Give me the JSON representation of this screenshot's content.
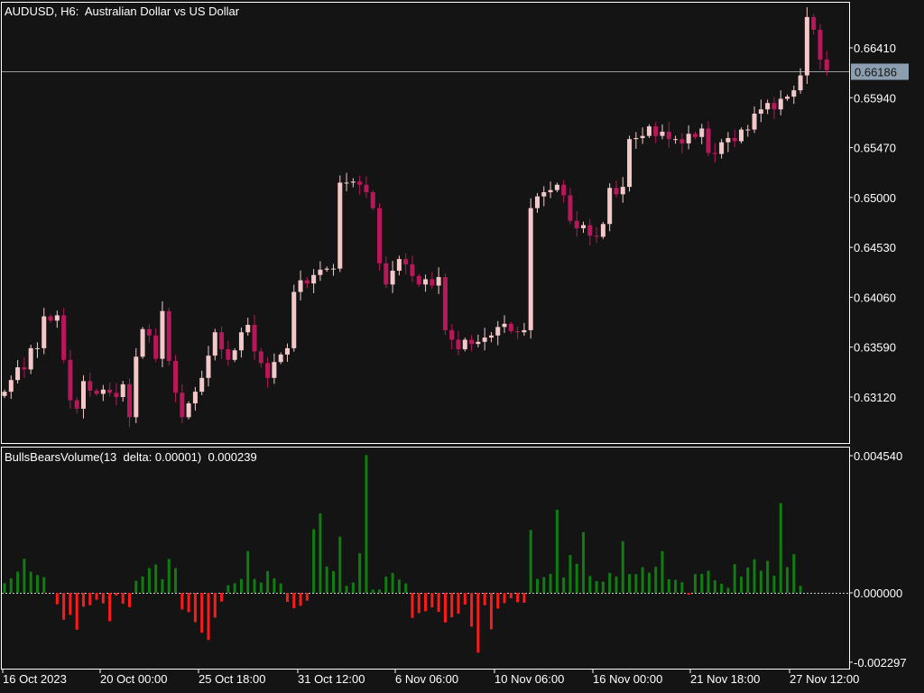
{
  "header": {
    "symbol_line": "AUDUSD, H6:  Australian Dollar vs US Dollar"
  },
  "indicator": {
    "label": "BullsBearsVolume(13  delta: 0.00001)  0.000239"
  },
  "colors": {
    "background": "#141414",
    "grid_border": "#ffffff",
    "bull_candle": "#f3c8c8",
    "bear_candle": "#b8185a",
    "bull_bar": "#0f7d0f",
    "bear_bar": "#ff1a1a",
    "price_line": "#9a9a9a",
    "current_price_box": "#8c9fb0"
  },
  "chart_data": [
    {
      "type": "candlestick",
      "title": "AUDUSD, H6:  Australian Dollar vs US Dollar",
      "ylim": [
        0.6283,
        0.6695
      ],
      "y_ticks": [
        "0.66410",
        "0.65940",
        "0.65470",
        "0.65000",
        "0.64530",
        "0.64060",
        "0.63590",
        "0.63120"
      ],
      "y_tick_values": [
        0.6641,
        0.6594,
        0.6547,
        0.65,
        0.6453,
        0.6406,
        0.6359,
        0.6312
      ],
      "current_price": 0.66186,
      "current_price_label": "0.66186",
      "x_labels": [
        "16 Oct 2023",
        "20 Oct 00:00",
        "25 Oct 18:00",
        "31 Oct 12:00",
        "6 Nov 06:00",
        "10 Nov 06:00",
        "16 Nov 00:00",
        "21 Nov 18:00",
        "27 Nov 12:00"
      ],
      "close": [
        0.6317,
        0.6328,
        0.634,
        0.6338,
        0.6358,
        0.6358,
        0.6388,
        0.6384,
        0.6389,
        0.6347,
        0.6309,
        0.6301,
        0.6327,
        0.6318,
        0.6315,
        0.6319,
        0.6316,
        0.6312,
        0.6324,
        0.6293,
        0.635,
        0.6376,
        0.637,
        0.6348,
        0.6393,
        0.6346,
        0.6316,
        0.6293,
        0.6306,
        0.6317,
        0.633,
        0.6351,
        0.6373,
        0.6357,
        0.6347,
        0.6356,
        0.6373,
        0.638,
        0.6355,
        0.6344,
        0.633,
        0.6345,
        0.6352,
        0.6358,
        0.6411,
        0.6422,
        0.6419,
        0.6427,
        0.6432,
        0.6433,
        0.6433,
        0.6514,
        0.6514,
        0.6515,
        0.6512,
        0.6505,
        0.649,
        0.6438,
        0.6418,
        0.6431,
        0.6442,
        0.6437,
        0.6426,
        0.6418,
        0.6423,
        0.6417,
        0.6425,
        0.6375,
        0.6366,
        0.6357,
        0.6366,
        0.6362,
        0.6364,
        0.6368,
        0.637,
        0.6378,
        0.6381,
        0.6374,
        0.6373,
        0.6375,
        0.649,
        0.6501,
        0.6505,
        0.6507,
        0.6512,
        0.6502,
        0.6478,
        0.6471,
        0.6474,
        0.6464,
        0.6463,
        0.6475,
        0.6509,
        0.6503,
        0.651,
        0.6555,
        0.6556,
        0.6558,
        0.6567,
        0.6558,
        0.6562,
        0.6555,
        0.6555,
        0.6551,
        0.656,
        0.6557,
        0.6565,
        0.6542,
        0.6541,
        0.6552,
        0.6556,
        0.6553,
        0.6564,
        0.6564,
        0.6579,
        0.6583,
        0.6589,
        0.6583,
        0.6593,
        0.6595,
        0.6601,
        0.6615,
        0.667,
        0.6658,
        0.663,
        0.662
      ],
      "volume": [
        0.00032,
        0.00048,
        0.0007,
        0.00113,
        0.0007,
        0.00059,
        0.00052,
        0.0,
        -0.00038,
        -0.00089,
        -0.00073,
        -0.00122,
        -0.00046,
        -0.00041,
        -0.00023,
        -0.00035,
        -0.00094,
        -9e-05,
        -0.00036,
        -0.00047,
        0.0004,
        0.00054,
        0.00082,
        0.00094,
        0.00045,
        0.00112,
        0.00082,
        -0.00055,
        -0.00064,
        -0.00097,
        -0.00132,
        -0.00156,
        -0.00082,
        -0.00029,
        0.00025,
        0.00032,
        0.00046,
        0.00138,
        0.00046,
        0.00034,
        0.00072,
        0.00048,
        0.00031,
        -0.0003,
        -0.00051,
        -0.00043,
        -0.00026,
        0.00211,
        0.00263,
        0.00087,
        0.00072,
        0.00186,
        0.00023,
        0.00034,
        0.00131,
        0.00456,
        0.00011,
        0.00011,
        0.00054,
        0.00066,
        0.00044,
        0.00031,
        -0.00083,
        -0.00067,
        -0.00061,
        -0.00048,
        -0.00063,
        -0.00098,
        -0.00081,
        -0.00069,
        -0.00039,
        -0.00112,
        -0.00198,
        -0.00041,
        -0.00121,
        -0.00052,
        -0.00034,
        -0.00018,
        -0.00031,
        -0.00033,
        0.00208,
        0.00046,
        0.00052,
        0.00063,
        0.00275,
        0.00051,
        0.00125,
        0.00096,
        0.00201,
        0.00056,
        0.00039,
        0.00037,
        0.00066,
        0.00054,
        0.00171,
        0.00062,
        0.00062,
        0.00085,
        0.00067,
        0.00086,
        0.00138,
        0.00045,
        0.00043,
        0.00035,
        -6e-05,
        0.00062,
        0.00063,
        0.00073,
        0.00042,
        0.0003,
        0.00017,
        0.00095,
        0.00054,
        0.00084,
        0.00111,
        0.00073,
        0.00106,
        0.00057,
        0.00297,
        0.00085,
        0.00128,
        0.00023
      ],
      "volume_ylim": [
        -0.002297,
        0.00454
      ],
      "volume_ticks": [
        "0.004540",
        "0.000000",
        "-0.002297"
      ],
      "volume_tick_values": [
        0.00454,
        0.0,
        -0.002297
      ]
    }
  ]
}
